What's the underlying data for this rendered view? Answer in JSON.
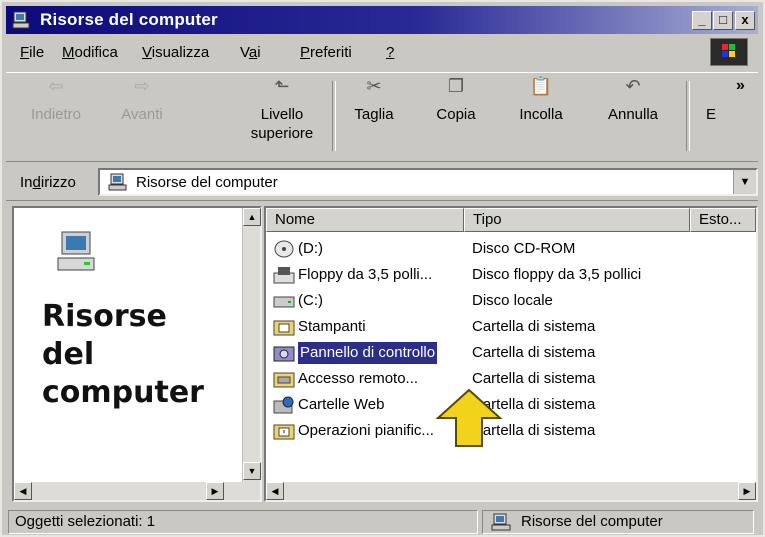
{
  "window": {
    "title": "Risorse del computer"
  },
  "title_buttons": {
    "minimize": "_",
    "maximize": "□",
    "close": "x"
  },
  "menu": [
    {
      "prefix": "",
      "key": "F",
      "rest": "ile"
    },
    {
      "prefix": "",
      "key": "M",
      "rest": "odifica"
    },
    {
      "prefix": "",
      "key": "V",
      "rest": "isualizza"
    },
    {
      "prefix": "V",
      "key": "a",
      "rest": "i"
    },
    {
      "prefix": "",
      "key": "P",
      "rest": "referiti"
    },
    {
      "prefix": "",
      "key": "?",
      "rest": ""
    }
  ],
  "toolbar": {
    "back": "Indietro",
    "forward": "Avanti",
    "up_line1": "Livello",
    "up_line2": "superiore",
    "cut": "Taglia",
    "copy": "Copia",
    "paste": "Incolla",
    "undo": "Annulla",
    "more": "E",
    "chevron": "»"
  },
  "address": {
    "label_pre": "In",
    "label_key": "d",
    "label_post": "irizzo",
    "value": "Risorse del computer",
    "dropdown": "▼"
  },
  "left_panel": {
    "title_line1": "Risorse",
    "title_line2": "del",
    "title_line3": "computer"
  },
  "list": {
    "columns": [
      "Nome",
      "Tipo",
      "Esto..."
    ],
    "items": [
      {
        "name": "(D:)",
        "type": "Disco CD-ROM",
        "icon": "cdrom-icon",
        "selected": false
      },
      {
        "name": "Floppy da 3,5 polli...",
        "type": "Disco floppy da 3,5 pollici",
        "icon": "floppy-icon",
        "selected": false
      },
      {
        "name": "(C:)",
        "type": "Disco locale",
        "icon": "harddisk-icon",
        "selected": false
      },
      {
        "name": "Stampanti",
        "type": "Cartella di sistema",
        "icon": "printers-folder-icon",
        "selected": false
      },
      {
        "name": "Pannello di controllo",
        "type": "Cartella di sistema",
        "icon": "control-panel-icon",
        "selected": true
      },
      {
        "name": "Accesso remoto...",
        "type": "Cartella di sistema",
        "icon": "dialup-icon",
        "selected": false
      },
      {
        "name": "Cartelle Web",
        "type": "Cartella di sistema",
        "icon": "web-folders-icon",
        "selected": false
      },
      {
        "name": "Operazioni pianific...",
        "type": "Cartella di sistema",
        "icon": "scheduled-tasks-icon",
        "selected": false
      }
    ]
  },
  "status": {
    "left": "Oggetti selezionati: 1",
    "right": "Risorse del computer"
  },
  "colors": {
    "titlebar_start": "#0c0a7a",
    "titlebar_end": "#a7aed4",
    "selection": "#2b2f8a",
    "arrow": "#f2d21a"
  },
  "annotation": {
    "arrow": "yellow-pointer-arrow"
  }
}
